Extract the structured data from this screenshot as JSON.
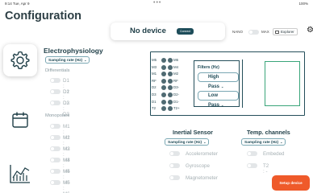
{
  "status_bar": {
    "time": "9:14 Tue, Apr 9",
    "center_dots": "•••",
    "right": "100%"
  },
  "page_title": "Configuration",
  "header": {
    "device_status": "No device",
    "connect_label": "Connect",
    "nano_label": "NANO",
    "max_label": "MAX",
    "explorer_label": "Explorer"
  },
  "sidebar": {
    "items": [
      {
        "name": "settings",
        "active": true
      },
      {
        "name": "calendar",
        "active": false
      },
      {
        "name": "chart",
        "active": false
      }
    ]
  },
  "electrophysiology": {
    "title": "Electrophysiology",
    "sampling_select": "Sampling rate (Hz)",
    "differentials_label": "Differentials",
    "differentials": [
      "D1 : D1",
      "D2 : D2",
      "D3 : D3"
    ],
    "monopolars_label": "Monopolars",
    "monopolars": [
      "M1 : M1",
      "M2 : M2",
      "M3 : M3",
      "M4 : M4",
      "M5 : M5",
      "M6 : M6"
    ]
  },
  "diagram": {
    "pins": [
      {
        "left": "M5",
        "right": "M6"
      },
      {
        "left": "M3",
        "right": "M4"
      },
      {
        "left": "M1",
        "right": "M2"
      },
      {
        "left": "RF",
        "right": "RF"
      },
      {
        "left": "D2",
        "right": "D3-"
      },
      {
        "left": "D3",
        "right": "D2-"
      },
      {
        "left": "D1",
        "right": "D1-"
      },
      {
        "left": "T2",
        "right": "T2+"
      }
    ],
    "filters_label": "Filters (Hz)",
    "high_pass": "High Pass",
    "low_pass": "Low Pass"
  },
  "inertial_sensor": {
    "title": "Inertial Sensor",
    "sampling_select": "Sampling rate (Hz)",
    "items": [
      "Accelerometer",
      "Gyroscope",
      "Magnetometer"
    ]
  },
  "temp_channels": {
    "title": "Temp. channels",
    "sampling_select": "Sampling rate (Hz)",
    "items": [
      "Embeded",
      "T2 : -"
    ]
  },
  "setup_button": "Setup device",
  "colors": {
    "accent": "#1e4d5a",
    "setup": "#ef5a2a",
    "toggle_off": "#e3e6e8"
  }
}
